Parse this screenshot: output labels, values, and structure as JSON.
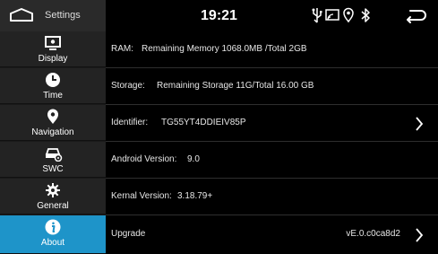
{
  "statusbar": {
    "title": "Settings",
    "time": "19:21"
  },
  "sidebar": {
    "items": [
      {
        "label": "Display",
        "icon": "display-icon"
      },
      {
        "label": "Time",
        "icon": "clock-icon"
      },
      {
        "label": "Navigation",
        "icon": "map-pin-icon"
      },
      {
        "label": "SWC",
        "icon": "steering-car-icon"
      },
      {
        "label": "General",
        "icon": "gear-icon"
      },
      {
        "label": "About",
        "icon": "info-icon"
      }
    ],
    "active": "About"
  },
  "rows": [
    {
      "label": "RAM:",
      "value": "Remaining Memory 1068.0MB /Total 2GB"
    },
    {
      "label": "Storage:",
      "value": "Remaining Storage 11G/Total  16.00 GB"
    },
    {
      "label": "Identifier:",
      "value": "TG55YT4DDIEIV85P"
    },
    {
      "label": "Android Version:",
      "value": "9.0"
    },
    {
      "label": "Kernal Version:",
      "value": "3.18.79+"
    },
    {
      "label": "Upgrade",
      "value": "vE.0.c0ca8d2"
    }
  ],
  "colors": {
    "accent": "#1e94c9",
    "background": "#000000",
    "sidebar": "#232323"
  }
}
